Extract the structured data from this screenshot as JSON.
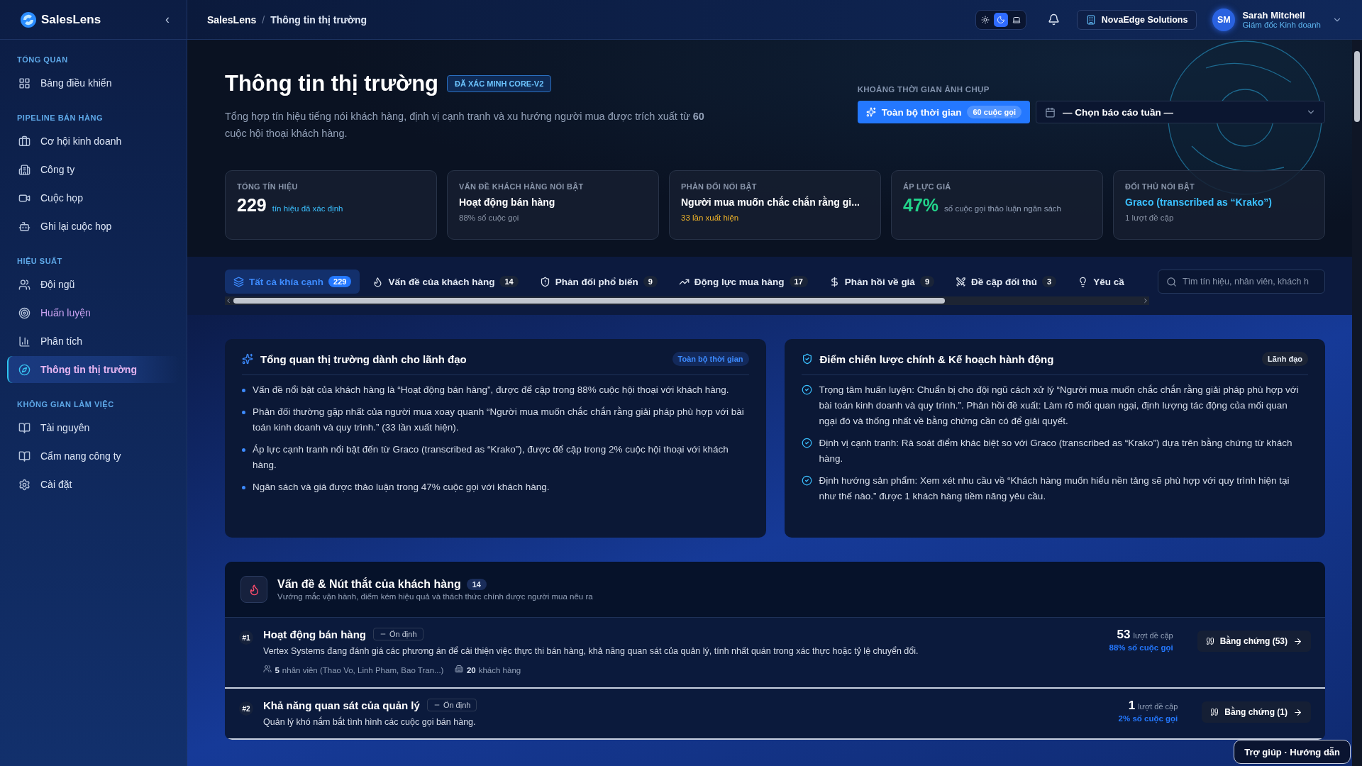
{
  "sidebar": {
    "brand": "SalesLens",
    "collapse": "‹",
    "sections": [
      {
        "title": "TỔNG QUAN",
        "items": [
          {
            "label": "Bảng điều khiển",
            "selected": false,
            "hovered": false
          }
        ]
      },
      {
        "title": "PIPELINE BÁN HÀNG",
        "items": [
          {
            "label": "Cơ hội kinh doanh",
            "selected": false,
            "hovered": false
          },
          {
            "label": "Công ty",
            "selected": false,
            "hovered": false
          },
          {
            "label": "Cuộc họp",
            "selected": false,
            "hovered": false
          },
          {
            "label": "Ghi lại cuộc họp",
            "selected": false,
            "hovered": false
          }
        ]
      },
      {
        "title": "HIỆU SUẤT",
        "items": [
          {
            "label": "Đội ngũ",
            "selected": false,
            "hovered": false
          },
          {
            "label": "Huấn luyện",
            "selected": false,
            "hovered": true
          },
          {
            "label": "Phân tích",
            "selected": false,
            "hovered": false
          },
          {
            "label": "Thông tin thị trường",
            "selected": true,
            "hovered": false
          }
        ]
      },
      {
        "title": "KHÔNG GIAN LÀM VIỆC",
        "items": [
          {
            "label": "Tài nguyên",
            "selected": false,
            "hovered": false
          },
          {
            "label": "Cẩm nang công ty",
            "selected": false,
            "hovered": false
          },
          {
            "label": "Cài đặt",
            "selected": false,
            "hovered": false
          }
        ]
      }
    ]
  },
  "header": {
    "breadcrumb": [
      "SalesLens",
      "Thông tin thị trường"
    ],
    "separator": "/",
    "theme_modes": [
      {
        "selected": false
      },
      {
        "selected": true
      },
      {
        "selected": false
      }
    ],
    "company": "NovaEdge Solutions",
    "user": {
      "initials": "SM",
      "name": "Sarah Mitchell",
      "role": "Giám đốc Kinh doanh"
    }
  },
  "hero": {
    "title": "Thông tin thị trường",
    "badge": "ĐÃ XÁC MINH CORE-V2",
    "description": "Tổng hợp tín hiệu tiếng nói khách hàng, định vị cạnh tranh và xu hướng người mua được trích xuất từ **60** cuộc hội thoại khách hàng.",
    "snapshot": {
      "label": "KHOẢNG THỜI GIAN ẢNH CHỤP",
      "all_time": {
        "label": "Toàn bộ thời gian",
        "badge": "60 cuộc gọi",
        "selected": true
      },
      "week_select": {
        "placeholder": "— Chọn báo cáo tuần —"
      }
    }
  },
  "stats": [
    {
      "kind": "count",
      "label": "TỔNG TÍN HIỆU",
      "value": "229",
      "caption": "tín hiệu đã xác định"
    },
    {
      "kind": "text",
      "label": "VẤN ĐỀ KHÁCH HÀNG NỔI BẬT",
      "value": "Hoạt động bán hàng",
      "caption": "88% số cuộc gọi",
      "color": "#8b95a7"
    },
    {
      "kind": "text",
      "label": "PHẢN ĐỐI NỔI BẬT",
      "value": "Người mua muốn chắc chắn rằng gi...",
      "caption": "33 lần xuất hiện",
      "color": "#f0b429"
    },
    {
      "kind": "percent",
      "label": "ÁP LỰC GIÁ",
      "value": "47%",
      "caption": "số cuộc gọi thảo luận ngân sách"
    },
    {
      "kind": "competitor",
      "label": "ĐỐI THỦ NỔI BẬT",
      "value": "Graco (transcribed as “Krako”)",
      "caption": "1 lượt đề cập",
      "color": "#8b95a7"
    }
  ],
  "tabs": [
    {
      "label": "Tất cả khía cạnh",
      "count": "229",
      "selected": true
    },
    {
      "label": "Vấn đề của khách hàng",
      "count": "14",
      "selected": false
    },
    {
      "label": "Phản đối phổ biến",
      "count": "9",
      "selected": false
    },
    {
      "label": "Động lực mua hàng",
      "count": "17",
      "selected": false
    },
    {
      "label": "Phản hồi về giá",
      "count": "9",
      "selected": false
    },
    {
      "label": "Đề cập đối thủ",
      "count": "3",
      "selected": false
    },
    {
      "label": "Yêu cầ",
      "selected": false
    }
  ],
  "search": {
    "placeholder": "Tìm tín hiệu, nhân viên, khách h"
  },
  "overview": {
    "title": "Tổng quan thị trường dành cho lãnh đạo",
    "badge": "Toàn bộ thời gian",
    "bullets": [
      "Vấn đề nổi bật của khách hàng là “Hoạt động bán hàng”, được để cập trong 88% cuộc hội thoại với khách hàng.",
      "Phản đối thường gặp nhất của người mua xoay quanh “Người mua muốn chắc chắn rằng giải pháp phù hợp với bài toán kinh doanh và quy trình.” (33 lần xuất hiện).",
      "Áp lực cạnh tranh nổi bật đến từ Graco (transcribed as “Krako”), được để cập trong 2% cuộc hội thoại với khách hàng.",
      "Ngân sách và giá được thảo luận trong 47% cuộc gọi với khách hàng."
    ]
  },
  "strategy": {
    "title": "Điểm chiến lược chính & Kế hoạch hành động",
    "badge": "Lãnh đạo",
    "items": [
      "Trọng tâm huấn luyện: Chuẩn bị cho đội ngũ cách xử lý “Người mua muốn chắc chắn rằng giải pháp phù hợp với bài toán kinh doanh và quy trình.”. Phản hồi đề xuất: Làm rõ mối quan ngại, định lượng tác động của mối quan ngại đó và thống nhất về bằng chứng cần có để giải quyết.",
      "Định vị cạnh tranh: Rà soát điểm khác biệt so với Graco (transcribed as “Krako”) dựa trên bằng chứng từ khách hàng.",
      "Định hướng sản phẩm: Xem xét nhu cầu về “Khách hàng muốn hiểu nền tảng sẽ phù hợp với quy trình hiện tại như thế nào.” được 1 khách hàng tiềm năng yêu cầu."
    ]
  },
  "issues": {
    "title": "Vấn đề & Nút thắt của khách hàng",
    "count": "14",
    "subtitle": "Vướng mắc vận hành, điểm kém hiệu quả và thách thức chính được người mua nêu ra",
    "rows": [
      {
        "rank": "#1",
        "title": "Hoạt động bán hàng",
        "status": "Ổn định",
        "description": "Vertex Systems đang đánh giá các phương án để cải thiện việc thực thi bán hàng, khả năng quan sát của quản lý, tính nhất quán trong xác thực hoặc tỷ lệ chuyển đổi.",
        "staff_count": "5",
        "staff_text": "nhân viên (Thao Vo, Linh Pham, Bao Tran...)",
        "customer_count": "20",
        "customer_text": "khách hàng",
        "mentions": "53",
        "mentions_label": "lượt đề cập",
        "share": "88% số cuộc gọi",
        "evidence": "Bằng chứng (53)"
      },
      {
        "rank": "#2",
        "title": "Khả năng quan sát của quản lý",
        "status": "Ổn định",
        "description": "Quản lý khó nắm bắt tình hình các cuộc gọi bán hàng.",
        "mentions": "1",
        "mentions_label": "lượt đề cập",
        "share": "2% số cuộc gọi",
        "evidence": "Bằng chứng (1)"
      }
    ]
  },
  "help": "Trợ giúp · Hướng dẫn"
}
